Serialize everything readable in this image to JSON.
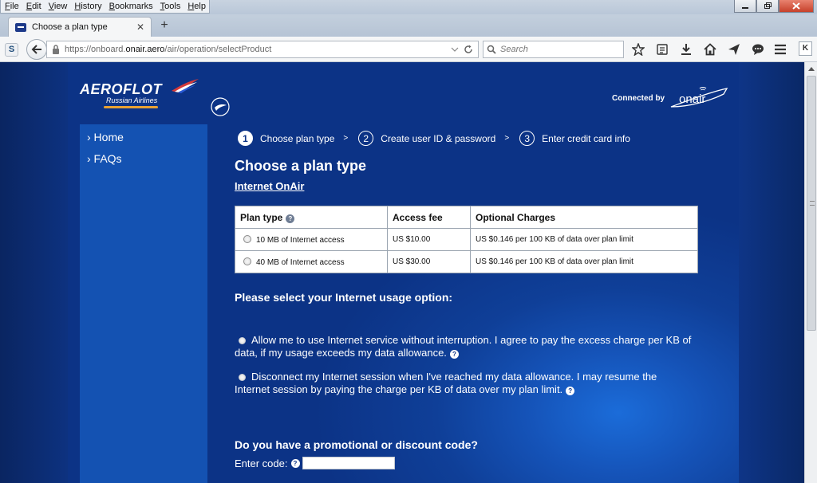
{
  "browser": {
    "menu": [
      "File",
      "Edit",
      "View",
      "History",
      "Bookmarks",
      "Tools",
      "Help"
    ],
    "tab_title": "Choose a plan type",
    "url_prefix": "https://onboard.",
    "url_domain": "onair.aero",
    "url_path": "/air/operation/selectProduct",
    "search_placeholder": "Search",
    "addon_label": "S",
    "ext_label": "K"
  },
  "page": {
    "logo_text": "AEROFLOT",
    "logo_subtext": "Russian Airlines",
    "connected_by": "Connected by",
    "onair_text": "onair",
    "sidebar": [
      {
        "label": "› Home"
      },
      {
        "label": "› FAQs"
      }
    ],
    "steps": [
      {
        "num": "1",
        "label": "Choose plan type"
      },
      {
        "num": "2",
        "label": "Create user ID & password"
      },
      {
        "num": "3",
        "label": "Enter credit card info"
      }
    ],
    "step_separator": ">",
    "heading": "Choose a plan type",
    "subheading": "Internet OnAir",
    "table": {
      "headers": [
        "Plan type",
        "Access fee",
        "Optional Charges"
      ],
      "rows": [
        {
          "plan": "10 MB of Internet access",
          "fee": "US $10.00",
          "charges": "US $0.146 per 100 KB of data over plan limit"
        },
        {
          "plan": "40 MB of Internet access",
          "fee": "US $30.00",
          "charges": "US $0.146 per 100 KB of data over plan limit"
        }
      ]
    },
    "usage_title": "Please select your Internet usage option:",
    "options": [
      "Allow me to use Internet service without interruption. I agree to pay the excess charge per KB of data, if my usage exceeds my data allowance.",
      "Disconnect my Internet session when I've reached my data allowance. I may resume the Internet session by paying the charge per KB of data over my plan limit."
    ],
    "promo_title": "Do you have a promotional or discount code?",
    "promo_label": "Enter code:",
    "help_glyph": "?"
  },
  "colors": {
    "page_blue": "#0c3386",
    "sidebar_blue": "#1452b2",
    "accent_orange": "#e9a234"
  }
}
